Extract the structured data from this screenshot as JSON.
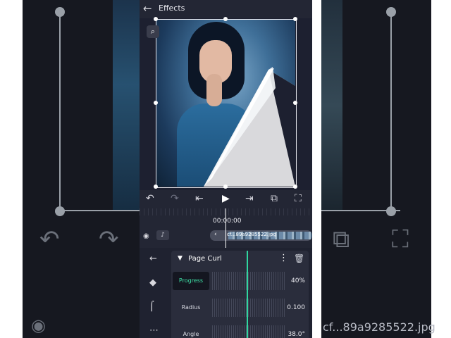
{
  "header": {
    "back_icon": "arrow-left-icon",
    "title": "Effects"
  },
  "canvas": {
    "zoom_icon": "magnifier-icon"
  },
  "toolbar": {
    "undo_icon": "undo-icon",
    "redo_icon": "redo-icon",
    "skip_start_icon": "skip-to-start-icon",
    "play_icon": "play-icon",
    "skip_end_icon": "skip-to-end-icon",
    "copy_icon": "duplicate-icon",
    "fullscreen_icon": "crop-frame-icon"
  },
  "timeline": {
    "timecode": "00:00:00",
    "clip_label": "cf...89a9285522.jpg",
    "background_clip_label": "cf...89a9285522.jpg"
  },
  "effect_panel": {
    "effect_name": "Page Curl",
    "params": [
      {
        "label": "Progress",
        "value": "40%",
        "active": true
      },
      {
        "label": "Radius",
        "value": "0.100",
        "active": false
      },
      {
        "label": "Angle",
        "value": "38.0°",
        "active": false
      }
    ]
  },
  "colors": {
    "accent": "#2fd7a0",
    "panel": "#232634",
    "background": "#161820"
  }
}
